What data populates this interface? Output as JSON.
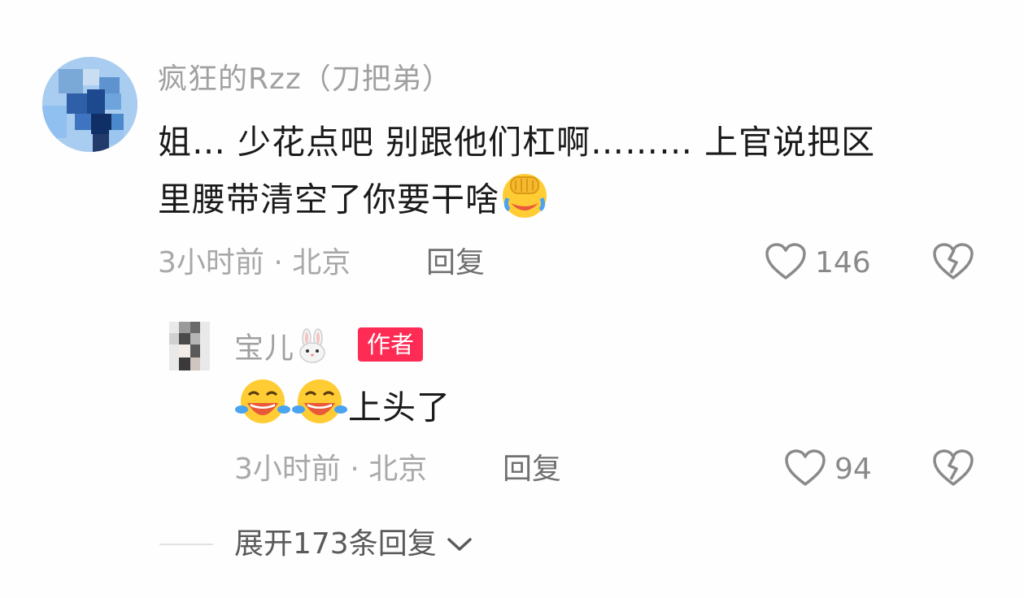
{
  "comment": {
    "username": "疯狂的Rzz（刀把弟）",
    "text_line1": "姐… 少花点吧  别跟他们杠啊……… 上官说把区",
    "text_line2": "里腰带清空了你要干啥",
    "text_emoji": "facepalm-laughing-emoji",
    "time_location": "3小时前 · 北京",
    "reply_label": "回复",
    "like_count": "146"
  },
  "reply": {
    "username": "宝儿",
    "username_emoji": "rabbit-face-emoji",
    "author_badge": "作者",
    "text": "上头了",
    "text_emojis": [
      "tears-of-joy-emoji",
      "tears-of-joy-emoji"
    ],
    "time_location": "3小时前 · 北京",
    "reply_label": "回复",
    "like_count": "94"
  },
  "expand": {
    "label": "展开173条回复",
    "icon": "chevron-down-icon"
  },
  "colors": {
    "badge": "#fe2c55",
    "username": "#a0a0a0",
    "text": "#1a1a1a",
    "meta": "#a8a8a8"
  }
}
